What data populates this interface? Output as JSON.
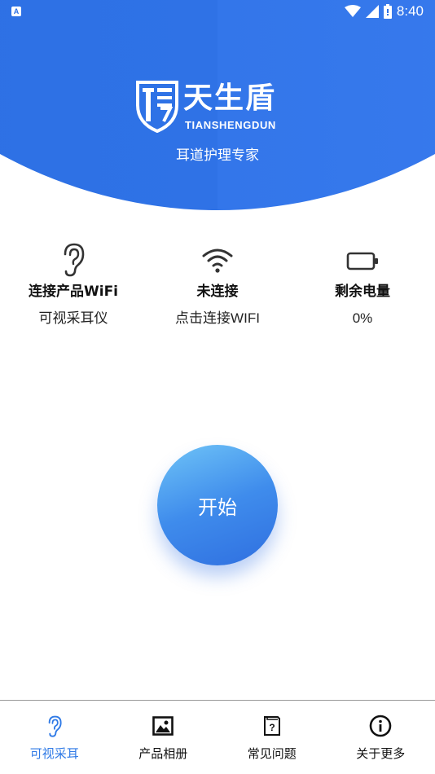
{
  "status_bar": {
    "notification_badge": "A",
    "time": "8:40"
  },
  "header": {
    "logo_text": "天生盾",
    "logo_subtext": "TIANSHENGDUN",
    "slogan": "耳道护理专家"
  },
  "info": [
    {
      "icon": "ear-icon",
      "title": "连接产品WiFi",
      "subtitle": "可视采耳仪"
    },
    {
      "icon": "wifi-icon",
      "title": "未连接",
      "subtitle": "点击连接WIFI"
    },
    {
      "icon": "battery-icon",
      "title": "剩余电量",
      "subtitle": "0%"
    }
  ],
  "start_button": {
    "label": "开始"
  },
  "bottom_nav": [
    {
      "icon": "ear-icon",
      "label": "可视采耳",
      "active": true
    },
    {
      "icon": "image-icon",
      "label": "产品相册",
      "active": false
    },
    {
      "icon": "question-icon",
      "label": "常见问题",
      "active": false
    },
    {
      "icon": "info-icon",
      "label": "关于更多",
      "active": false
    }
  ],
  "colors": {
    "primary": "#2f72e6",
    "active_tab": "#2f7ae6",
    "button_light": "#6fc4f7",
    "button_dark": "#2f6fe0"
  }
}
